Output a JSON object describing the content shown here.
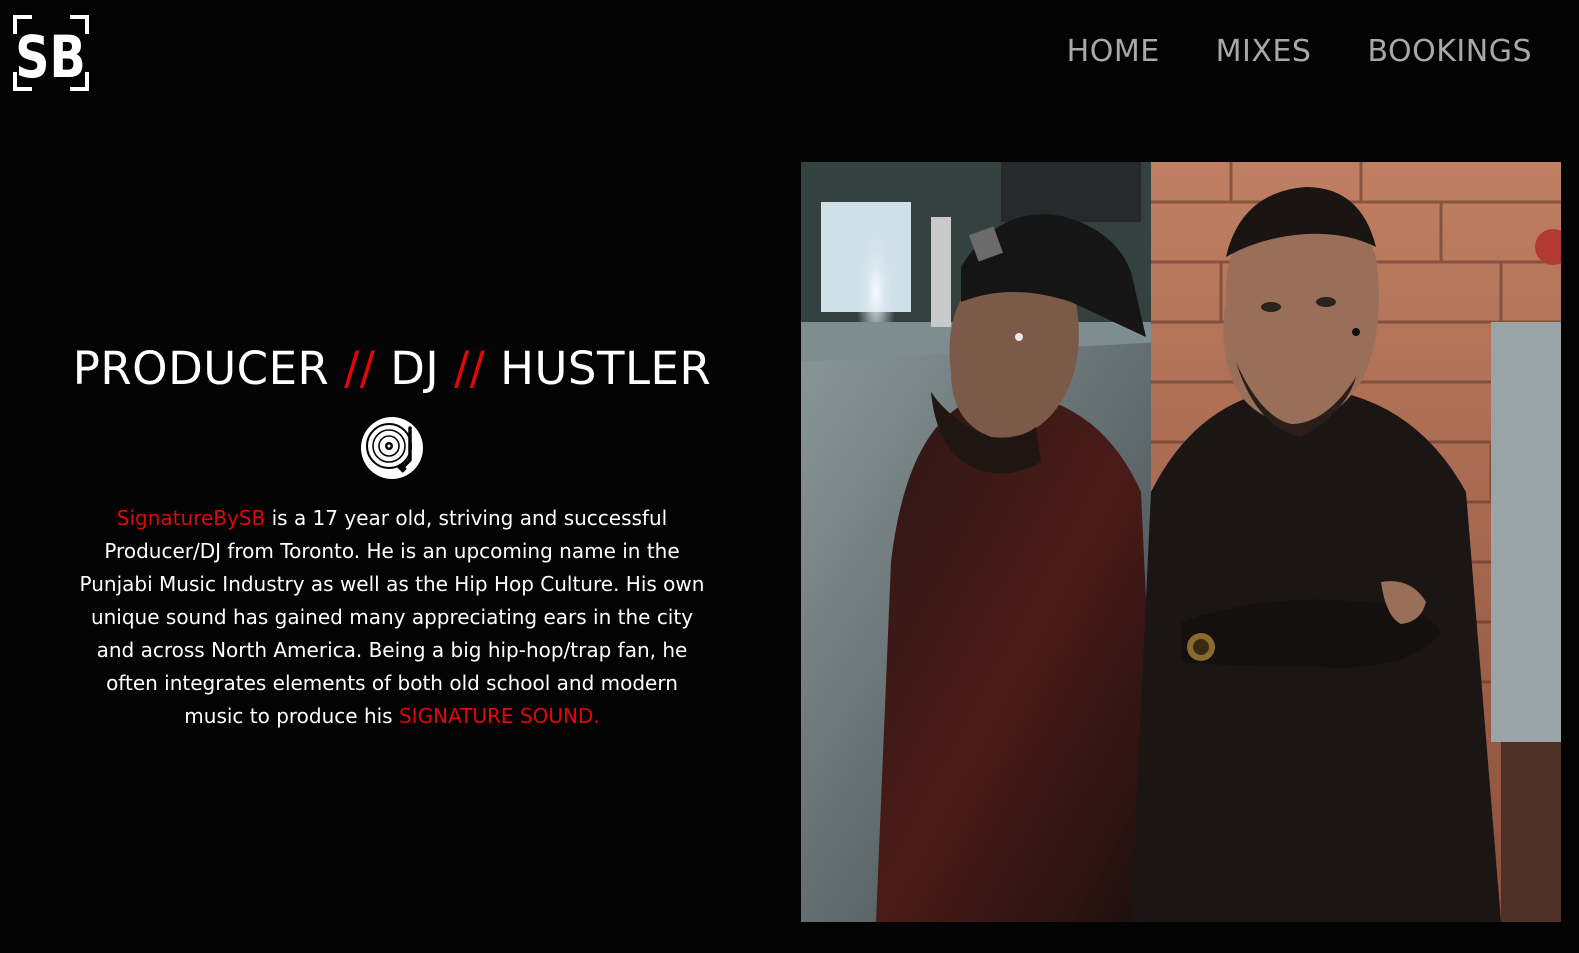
{
  "header": {
    "logo_text": "SB",
    "nav": [
      {
        "label": "HOME"
      },
      {
        "label": "MIXES"
      },
      {
        "label": "BOOKINGS"
      }
    ]
  },
  "intro": {
    "headline": {
      "part1": "PRODUCER",
      "sep1": "//",
      "part2": "DJ",
      "sep2": "//",
      "part3": "HUSTLER"
    },
    "icon": "vinyl-record-icon",
    "bio": {
      "brand": "SignatureBySB",
      "body": " is a 17 year old, striving and successful Producer/DJ from Toronto. He is an upcoming name in the Punjabi Music Industry as well as the Hip Hop Culture. His own unique sound has gained many appreciating ears in the city and across North America. Being a big hip-hop/trap fan, he often integrates elements of both old school and modern music to produce his ",
      "highlight": "SIGNATURE SOUND."
    }
  },
  "photo": {
    "subject": "two-men-portrait-photo"
  },
  "colors": {
    "background": "#030303",
    "accent": "#e1060a",
    "nav_text": "#a8a8a8",
    "text": "#ffffff"
  }
}
